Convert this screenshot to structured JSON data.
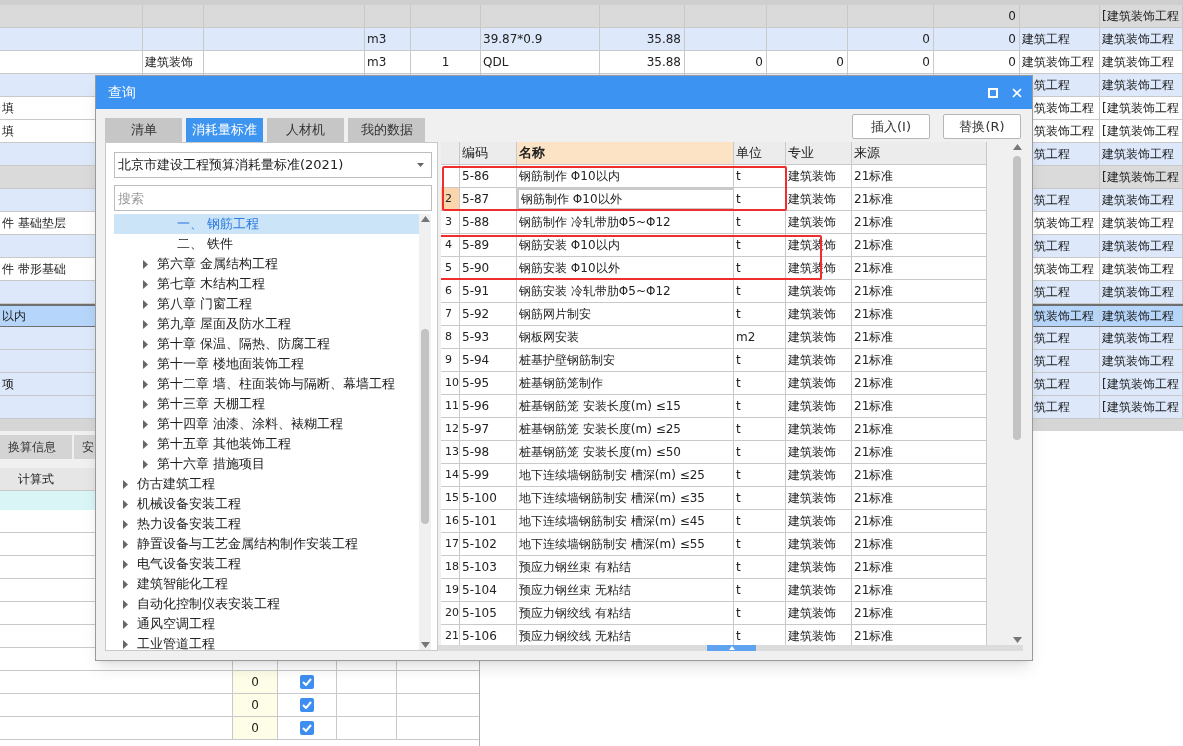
{
  "background_table": {
    "rows": [
      {
        "kind": "gray",
        "cells": {
          "c11": "0",
          "c13": "[建筑装饰工程"
        }
      },
      {
        "kind": "blue",
        "cells": {
          "c4": "m3",
          "c6": "39.87*0.9",
          "c7": "35.88",
          "c10": "0",
          "c11": "0",
          "c12": "建筑工程",
          "c13": "建筑装饰工程"
        }
      },
      {
        "kind": "white",
        "cells": {
          "c2": "建筑装饰",
          "c4": "m3",
          "c5": "1",
          "c6": "QDL",
          "c7": "35.88",
          "c8": "0",
          "c9": "0",
          "c10": "0",
          "c11": "0",
          "c12": "建筑装饰工程",
          "c13": "建筑装饰工程"
        }
      },
      {
        "kind": "blue",
        "cells": {
          "c12": "筑工程",
          "c13": "建筑装饰工程"
        }
      },
      {
        "kind": "white",
        "cells": {
          "c1": "填",
          "c12": "筑装饰工程",
          "c13": "[建筑装饰工程"
        }
      },
      {
        "kind": "white",
        "cells": {
          "c1": "填",
          "c12": "筑装饰工程",
          "c13": "[建筑装饰工程"
        }
      },
      {
        "kind": "blue",
        "cells": {
          "c12": "筑工程",
          "c13": "建筑装饰工程"
        }
      },
      {
        "kind": "gray",
        "cells": {
          "c13": "[建筑装饰工程"
        }
      },
      {
        "kind": "blue",
        "cells": {
          "c12": "筑工程",
          "c13": "建筑装饰工程"
        }
      },
      {
        "kind": "white",
        "cells": {
          "c1": "件 基础垫层",
          "c12": "筑装饰工程",
          "c13": "建筑装饰工程"
        }
      },
      {
        "kind": "blue",
        "cells": {
          "c12": "筑工程",
          "c13": "建筑装饰工程"
        }
      },
      {
        "kind": "white",
        "cells": {
          "c1": "件 带形基础",
          "c12": "筑装饰工程",
          "c13": "建筑装饰工程"
        }
      },
      {
        "kind": "blue",
        "cells": {
          "c12": "筑工程",
          "c13": "建筑装饰工程"
        }
      },
      {
        "kind": "selected",
        "cells": {
          "c1": "以内",
          "c12": "筑装饰工程",
          "c13": "建筑装饰工程"
        }
      },
      {
        "kind": "blue",
        "cells": {
          "c12": "筑工程",
          "c13": "建筑装饰工程"
        }
      },
      {
        "kind": "blue",
        "cells": {
          "c12": "筑工程",
          "c13": "建筑装饰工程"
        }
      },
      {
        "kind": "blue",
        "cells": {
          "c1": "项",
          "c12": "筑工程",
          "c13": "[建筑装饰工程"
        }
      },
      {
        "kind": "blue",
        "cells": {
          "c12": "筑工程",
          "c13": "[建筑装饰工程"
        }
      }
    ]
  },
  "bottom_panel": {
    "tabs": [
      {
        "label": "换算信息",
        "selected": false
      },
      {
        "label": "安",
        "selected": false
      }
    ],
    "header": "计算式",
    "rows": [
      {
        "selected": true
      },
      {
        "value": "0",
        "checked": true,
        "selected": false
      },
      {
        "value": "0",
        "checked": true,
        "selected": false
      },
      {
        "value": "0",
        "checked": true,
        "selected": false
      }
    ]
  },
  "dialog": {
    "title": "查询",
    "tabs": [
      {
        "label": "清单",
        "selected": false
      },
      {
        "label": "消耗量标准",
        "selected": true
      },
      {
        "label": "人材机",
        "selected": false
      },
      {
        "label": "我的数据",
        "selected": false
      }
    ],
    "buttons": [
      "插入(I)",
      "替换(R)"
    ],
    "standard": "北京市建设工程预算消耗量标准(2021)",
    "search": {
      "placeholder": "搜索"
    },
    "tree": [
      {
        "children": [
          {
            "children": [
              {
                "label": "一、 钢筋工程",
                "selected": true
              },
              {
                "label": "二、 铁件",
                "selected": false
              }
            ]
          },
          {
            "label": "第六章 金属结构工程",
            "expanded": false,
            "selected": false
          },
          {
            "label": "第七章 木结构工程",
            "expanded": false,
            "selected": false
          },
          {
            "label": "第八章 门窗工程",
            "expanded": false,
            "selected": false
          },
          {
            "label": "第九章 屋面及防水工程",
            "expanded": false,
            "selected": false
          },
          {
            "label": "第十章 保温、隔热、防腐工程",
            "expanded": false,
            "selected": false
          },
          {
            "label": "第十一章 楼地面装饰工程",
            "expanded": false,
            "selected": false
          },
          {
            "label": "第十二章 墙、柱面装饰与隔断、幕墙工程",
            "expanded": false,
            "selected": false
          },
          {
            "label": "第十三章 天棚工程",
            "expanded": false,
            "selected": false
          },
          {
            "label": "第十四章 油漆、涂料、裱糊工程",
            "expanded": false,
            "selected": false
          },
          {
            "label": "第十五章 其他装饰工程",
            "expanded": false,
            "selected": false
          },
          {
            "label": "第十六章 措施项目",
            "expanded": false,
            "selected": false
          }
        ]
      },
      {
        "label": "仿古建筑工程",
        "expanded": false,
        "selected": false
      },
      {
        "label": "机械设备安装工程",
        "expanded": false,
        "selected": false
      },
      {
        "label": "热力设备安装工程",
        "expanded": false,
        "selected": false
      },
      {
        "label": "静置设备与工艺金属结构制作安装工程",
        "expanded": false,
        "selected": false
      },
      {
        "label": "电气设备安装工程",
        "expanded": false,
        "selected": false
      },
      {
        "label": "建筑智能化工程",
        "expanded": false,
        "selected": false
      },
      {
        "label": "自动化控制仪表安装工程",
        "expanded": false,
        "selected": false
      },
      {
        "label": "通风空调工程",
        "expanded": false,
        "selected": false
      },
      {
        "label": "工业管道工程",
        "expanded": false,
        "selected": false
      }
    ],
    "table": {
      "columns": [
        {
          "label": "编码",
          "selected": false
        },
        {
          "label": "名称",
          "selected": true
        },
        {
          "label": "单位",
          "selected": false
        },
        {
          "label": "专业",
          "selected": false
        },
        {
          "label": "来源",
          "selected": false
        }
      ],
      "rows": [
        {
          "code": "5-86",
          "name": "钢筋制作 Φ10以内",
          "unit": "t",
          "major": "建筑装饰",
          "source": "21标准",
          "selected": false,
          "boxed": true
        },
        {
          "num": "2",
          "code": "5-87",
          "name": "钢筋制作 Φ10以外",
          "unit": "t",
          "major": "建筑装饰",
          "source": "21标准",
          "selected": true,
          "boxed": true
        },
        {
          "num": "3",
          "code": "5-88",
          "name": "钢筋制作 冷轧带肋Φ5~Φ12",
          "unit": "t",
          "major": "建筑装饰",
          "source": "21标准",
          "selected": false,
          "boxed": false
        },
        {
          "num": "4",
          "code": "5-89",
          "name": "钢筋安装 Φ10以内",
          "unit": "t",
          "major": "建筑装饰",
          "source": "21标准",
          "selected": false,
          "boxed": true
        },
        {
          "num": "5",
          "code": "5-90",
          "name": "钢筋安装 Φ10以外",
          "unit": "t",
          "major": "建筑装饰",
          "source": "21标准",
          "selected": false,
          "boxed": true
        },
        {
          "num": "6",
          "code": "5-91",
          "name": "钢筋安装 冷轧带肋Φ5~Φ12",
          "unit": "t",
          "major": "建筑装饰",
          "source": "21标准",
          "selected": false,
          "boxed": false
        },
        {
          "num": "7",
          "code": "5-92",
          "name": "钢筋网片制安",
          "unit": "t",
          "major": "建筑装饰",
          "source": "21标准",
          "selected": false,
          "boxed": false
        },
        {
          "num": "8",
          "code": "5-93",
          "name": "钢板网安装",
          "unit": "m2",
          "major": "建筑装饰",
          "source": "21标准",
          "selected": false,
          "boxed": false
        },
        {
          "num": "9",
          "code": "5-94",
          "name": "桩基护壁钢筋制安",
          "unit": "t",
          "major": "建筑装饰",
          "source": "21标准",
          "selected": false,
          "boxed": false
        },
        {
          "num": "10",
          "code": "5-95",
          "name": "桩基钢筋笼制作",
          "unit": "t",
          "major": "建筑装饰",
          "source": "21标准",
          "selected": false,
          "boxed": false
        },
        {
          "num": "11",
          "code": "5-96",
          "name": "桩基钢筋笼 安装长度(m) ≤15",
          "unit": "t",
          "major": "建筑装饰",
          "source": "21标准",
          "selected": false,
          "boxed": false
        },
        {
          "num": "12",
          "code": "5-97",
          "name": "桩基钢筋笼 安装长度(m) ≤25",
          "unit": "t",
          "major": "建筑装饰",
          "source": "21标准",
          "selected": false,
          "boxed": false
        },
        {
          "num": "13",
          "code": "5-98",
          "name": "桩基钢筋笼 安装长度(m) ≤50",
          "unit": "t",
          "major": "建筑装饰",
          "source": "21标准",
          "selected": false,
          "boxed": false
        },
        {
          "num": "14",
          "code": "5-99",
          "name": "地下连续墙钢筋制安 槽深(m) ≤25",
          "unit": "t",
          "major": "建筑装饰",
          "source": "21标准",
          "selected": false,
          "boxed": false
        },
        {
          "num": "15",
          "code": "5-100",
          "name": "地下连续墙钢筋制安 槽深(m) ≤35",
          "unit": "t",
          "major": "建筑装饰",
          "source": "21标准",
          "selected": false,
          "boxed": false
        },
        {
          "num": "16",
          "code": "5-101",
          "name": "地下连续墙钢筋制安 槽深(m) ≤45",
          "unit": "t",
          "major": "建筑装饰",
          "source": "21标准",
          "selected": false,
          "boxed": false
        },
        {
          "num": "17",
          "code": "5-102",
          "name": "地下连续墙钢筋制安 槽深(m) ≤55",
          "unit": "t",
          "major": "建筑装饰",
          "source": "21标准",
          "selected": false,
          "boxed": false
        },
        {
          "num": "18",
          "code": "5-103",
          "name": "预应力钢丝束 有粘结",
          "unit": "t",
          "major": "建筑装饰",
          "source": "21标准",
          "selected": false,
          "boxed": false
        },
        {
          "num": "19",
          "code": "5-104",
          "name": "预应力钢丝束 无粘结",
          "unit": "t",
          "major": "建筑装饰",
          "source": "21标准",
          "selected": false,
          "boxed": false
        },
        {
          "num": "20",
          "code": "5-105",
          "name": "预应力钢绞线 有粘结",
          "unit": "t",
          "major": "建筑装饰",
          "source": "21标准",
          "selected": false,
          "boxed": false
        },
        {
          "num": "21",
          "code": "5-106",
          "name": "预应力钢绞线 无粘结",
          "unit": "t",
          "major": "建筑装饰",
          "source": "21标准",
          "selected": false,
          "boxed": false
        }
      ]
    }
  }
}
